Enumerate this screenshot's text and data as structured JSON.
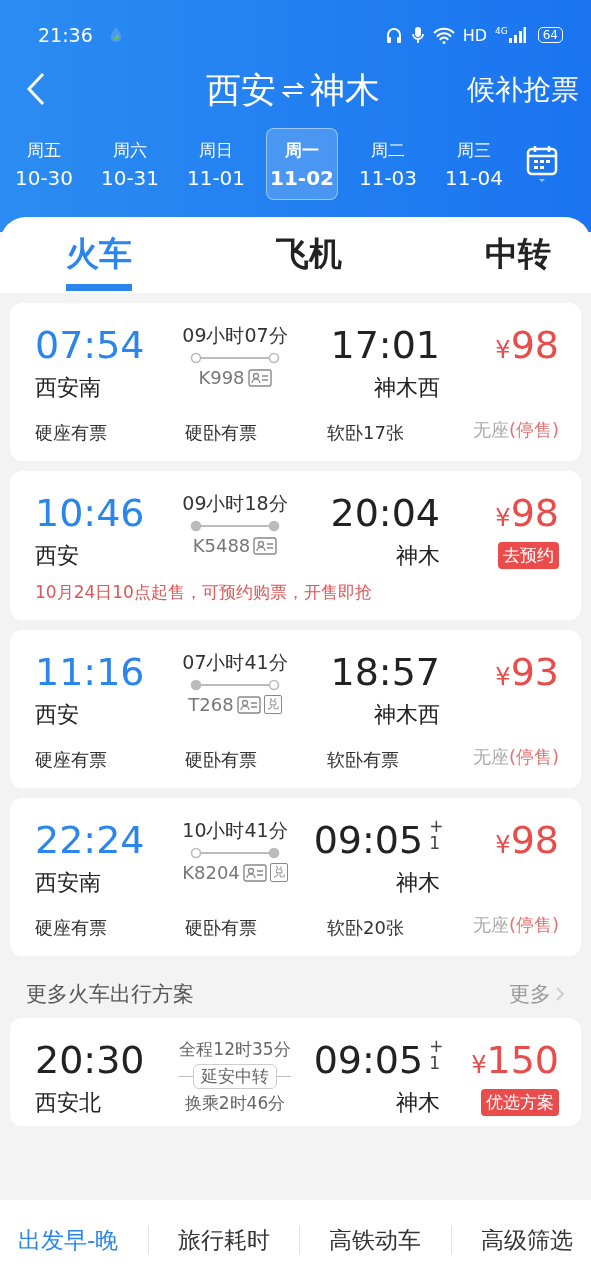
{
  "status_bar": {
    "time": "21:36",
    "network": "HD",
    "cell": "4G",
    "battery": "64"
  },
  "header": {
    "from": "西安",
    "to": "神木",
    "action": "候补抢票"
  },
  "dates": [
    {
      "weekday": "周五",
      "date": "10-30",
      "selected": false
    },
    {
      "weekday": "周六",
      "date": "10-31",
      "selected": false
    },
    {
      "weekday": "周日",
      "date": "11-01",
      "selected": false
    },
    {
      "weekday": "周一",
      "date": "11-02",
      "selected": true
    },
    {
      "weekday": "周二",
      "date": "11-03",
      "selected": false
    },
    {
      "weekday": "周三",
      "date": "11-04",
      "selected": false
    }
  ],
  "tabs": [
    {
      "label": "火车",
      "selected": true
    },
    {
      "label": "飞机",
      "selected": false
    },
    {
      "label": "中转",
      "selected": false
    }
  ],
  "trains": [
    {
      "depart": "07:54",
      "from": "西安南",
      "duration": "09小时07分",
      "start_filled": false,
      "end_filled": false,
      "number": "K998",
      "arrive": "17:01",
      "to": "神木西",
      "currency": "¥",
      "price": "98",
      "seats": [
        {
          "label": "硬座有票"
        },
        {
          "label": "硬卧有票"
        },
        {
          "label": "软卧17张"
        },
        {
          "label": "无座",
          "note": "(停售)"
        }
      ]
    },
    {
      "depart": "10:46",
      "from": "西安",
      "duration": "09小时18分",
      "start_filled": true,
      "end_filled": true,
      "number": "K5488",
      "arrive": "20:04",
      "to": "神木",
      "currency": "¥",
      "price": "98",
      "reserve": "去预约",
      "notice": "10月24日10点起售，可预约购票，开售即抢"
    },
    {
      "depart": "11:16",
      "from": "西安",
      "duration": "07小时41分",
      "start_filled": true,
      "end_filled": false,
      "number": "T268",
      "exchange": "兑",
      "arrive": "18:57",
      "to": "神木西",
      "currency": "¥",
      "price": "93",
      "seats": [
        {
          "label": "硬座有票"
        },
        {
          "label": "硬卧有票"
        },
        {
          "label": "软卧有票"
        },
        {
          "label": "无座",
          "note": "(停售)"
        }
      ]
    },
    {
      "depart": "22:24",
      "from": "西安南",
      "duration": "10小时41分",
      "start_filled": false,
      "end_filled": true,
      "number": "K8204",
      "exchange": "兑",
      "arrive": "09:05",
      "day_offset": "+1",
      "to": "神木",
      "currency": "¥",
      "price": "98",
      "seats": [
        {
          "label": "硬座有票"
        },
        {
          "label": "硬卧有票"
        },
        {
          "label": "软卧20张"
        },
        {
          "label": "无座",
          "note": "(停售)"
        }
      ]
    }
  ],
  "more": {
    "title": "更多火车出行方案",
    "link": "更多"
  },
  "transfer": {
    "depart": "20:30",
    "from": "西安北",
    "total": "全程12时35分",
    "via": "延安中转",
    "wait": "换乘2时46分",
    "arrive": "09:05",
    "day_offset": "+1",
    "to": "神木",
    "currency": "¥",
    "price": "150",
    "badge": "优选方案"
  },
  "sort_bar": [
    {
      "label": "出发早-晚",
      "selected": true
    },
    {
      "label": "旅行耗时",
      "selected": false
    },
    {
      "label": "高铁动车",
      "selected": false
    },
    {
      "label": "高级筛选",
      "selected": false
    }
  ]
}
